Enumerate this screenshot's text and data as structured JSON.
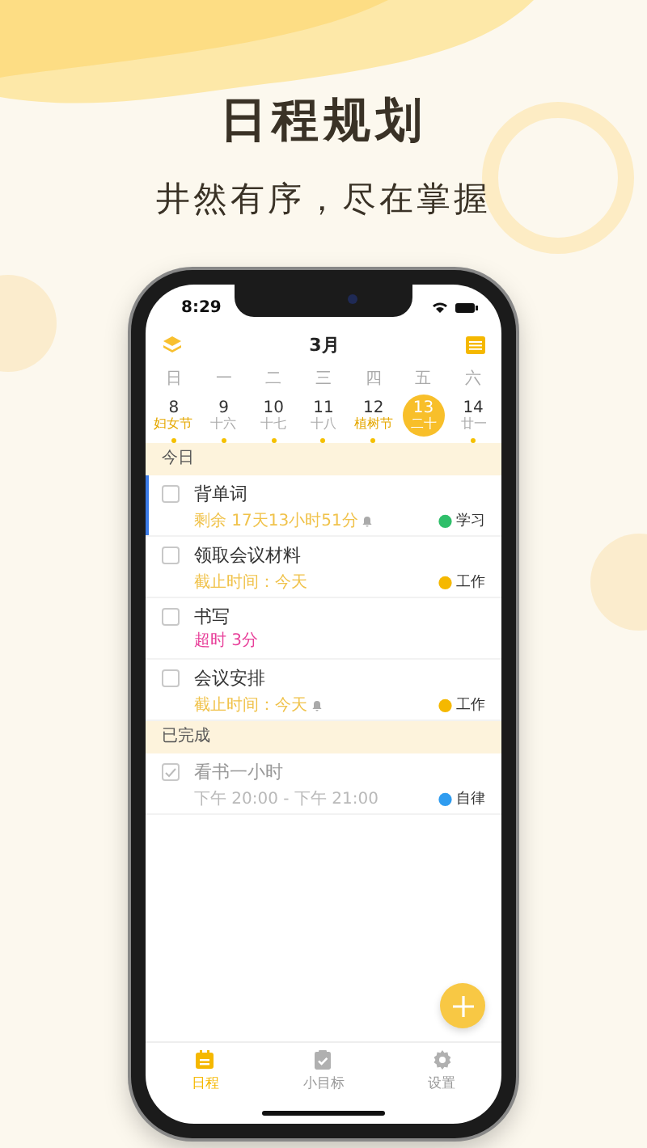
{
  "headline": "日程规划",
  "subheadline": "井然有序，尽在掌握",
  "status_bar": {
    "time": "8:29"
  },
  "header": {
    "month": "3月"
  },
  "weekdays": [
    "日",
    "一",
    "二",
    "三",
    "四",
    "五",
    "六"
  ],
  "dates": [
    {
      "day": "8",
      "lunar": "妇女节",
      "festival": true,
      "dot": true,
      "selected": false
    },
    {
      "day": "9",
      "lunar": "十六",
      "festival": false,
      "dot": true,
      "selected": false
    },
    {
      "day": "10",
      "lunar": "十七",
      "festival": false,
      "dot": true,
      "selected": false
    },
    {
      "day": "11",
      "lunar": "十八",
      "festival": false,
      "dot": true,
      "selected": false
    },
    {
      "day": "12",
      "lunar": "植树节",
      "festival": true,
      "dot": true,
      "selected": false
    },
    {
      "day": "13",
      "lunar": "二十",
      "festival": false,
      "dot": false,
      "selected": true
    },
    {
      "day": "14",
      "lunar": "廿一",
      "festival": false,
      "dot": true,
      "selected": false
    }
  ],
  "sections": [
    {
      "title": "今日",
      "tasks": [
        {
          "title": "背单词",
          "meta": "剩余 17天13小时51分",
          "kind": "remaining",
          "reminder": true,
          "tag": "学习",
          "color": "#2fbf6a",
          "checked": false,
          "highlighted": true
        },
        {
          "title": "领取会议材料",
          "meta": "截止时间：今天",
          "kind": "deadline",
          "reminder": false,
          "tag": "工作",
          "color": "#f5b800",
          "checked": false,
          "highlighted": false
        },
        {
          "title": "书写",
          "meta": "超时 3分",
          "kind": "overdue",
          "reminder": false,
          "checked": false,
          "highlighted": false
        },
        {
          "title": "会议安排",
          "meta": "截止时间：今天",
          "kind": "deadline",
          "reminder": true,
          "tag": "工作",
          "color": "#f5b800",
          "checked": false,
          "highlighted": false
        }
      ]
    },
    {
      "title": "已完成",
      "tasks": [
        {
          "title": "看书一小时",
          "meta": "下午 20:00 - 下午 21:00",
          "kind": "time",
          "reminder": false,
          "tag": "自律",
          "color": "#2f9cf0",
          "checked": true,
          "highlighted": false
        }
      ]
    }
  ],
  "tabs": [
    {
      "label": "日程",
      "selected": true
    },
    {
      "label": "小目标",
      "selected": false
    },
    {
      "label": "设置",
      "selected": false
    }
  ]
}
